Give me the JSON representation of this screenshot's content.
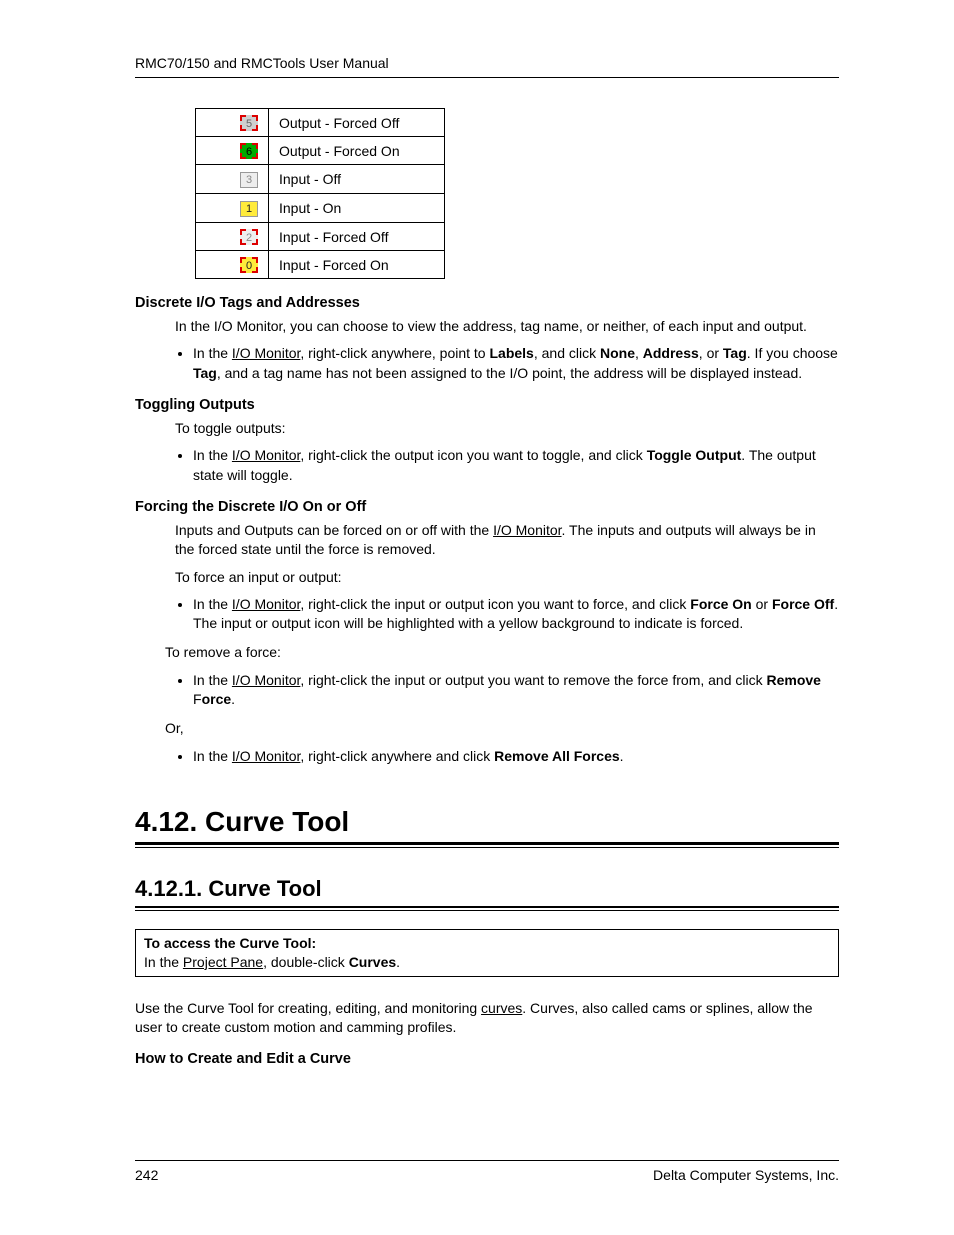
{
  "header": {
    "title": "RMC70/150 and RMCTools User Manual"
  },
  "io_table": [
    {
      "num": "5",
      "label": "Output - Forced Off",
      "style": "out-forced-off"
    },
    {
      "num": "6",
      "label": "Output - Forced On",
      "style": "out-forced-on"
    },
    {
      "num": "3",
      "label": "Input - Off",
      "style": "in-off"
    },
    {
      "num": "1",
      "label": "Input - On",
      "style": "in-on"
    },
    {
      "num": "2",
      "label": "Input - Forced Off",
      "style": "in-forced-off"
    },
    {
      "num": "0",
      "label": "Input - Forced On",
      "style": "in-forced-on"
    }
  ],
  "sections": {
    "discrete": {
      "heading": "Discrete I/O Tags and Addresses",
      "p1": "In the I/O Monitor, you can choose to view the address, tag name, or neither, of each input and output.",
      "li_a": "In the ",
      "li_link": "I/O Monitor",
      "li_b": ", right-click anywhere, point to ",
      "li_labels": "Labels",
      "li_c": ", and click ",
      "li_none": "None",
      "li_sep1": ", ",
      "li_addr": "Address",
      "li_sep2": ", or ",
      "li_tag": "Tag",
      "li_d": ". If you choose ",
      "li_tag2": "Tag",
      "li_e": ", and a tag name has not been assigned to the I/O point, the address will be displayed instead."
    },
    "toggling": {
      "heading": "Toggling Outputs",
      "p1": "To toggle outputs:",
      "li_a": "In the ",
      "li_link": "I/O Monitor",
      "li_b": ", right-click the output icon you want to toggle, and click ",
      "li_toggle": "Toggle Output",
      "li_c": ". The output state will toggle."
    },
    "forcing": {
      "heading": "Forcing the Discrete I/O On or Off",
      "p1_a": "Inputs and Outputs can be forced on or off with the ",
      "p1_link": "I/O Monitor",
      "p1_b": ". The inputs and outputs will always be in the forced state until the force is removed.",
      "p2": "To force an input or output:",
      "li1_a": "In the ",
      "li1_link": "I/O Monitor",
      "li1_b": ", right-click the input or output icon you want to force, and click ",
      "li1_fon": "Force On",
      "li1_or": " or ",
      "li1_foff": "Force Off",
      "li1_c": ". The input or output icon will be highlighted with a yellow background to indicate is forced.",
      "p3": "To remove a force:",
      "li2_a": "In the ",
      "li2_link": "I/O Monitor",
      "li2_b": ", right-click the input or output you want to remove the force from, and click ",
      "li2_rf1": "Remove ",
      "li2_rfF": "F",
      "li2_rf2": "orce",
      "li2_c": ".",
      "p4": "Or,",
      "li3_a": "In the ",
      "li3_link": "I/O Monitor",
      "li3_b": ", right-click anywhere and click ",
      "li3_raf": "Remove All Forces",
      "li3_c": "."
    }
  },
  "h1": "4.12. Curve Tool",
  "h2": "4.12.1. Curve Tool",
  "access": {
    "t1": "To access the Curve Tool:",
    "t2a": "In the ",
    "t2link": "Project Pane",
    "t2b": ", double-click ",
    "t2curves": "Curves",
    "t2c": "."
  },
  "curve_intro_a": "Use the Curve Tool for creating, editing, and monitoring ",
  "curve_intro_link": "curves",
  "curve_intro_b": ". Curves, also called cams or splines, allow the user to create custom motion and camming profiles.",
  "howto_heading": "How to Create and Edit a Curve",
  "footer": {
    "page": "242",
    "company": "Delta Computer Systems, Inc."
  }
}
